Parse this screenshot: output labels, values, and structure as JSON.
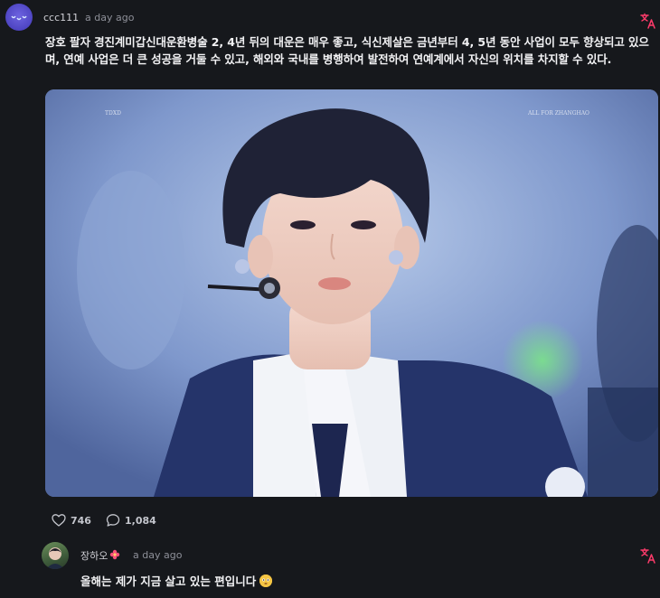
{
  "post": {
    "username": "ccc111",
    "timestamp": "a day ago",
    "text": "장호 팔자 경진계미갑신대운환병술 2, 4년 뒤의 대운은 매우 좋고, 식신제살은 금년부터 4, 5년 동안 사업이 모두 향상되고 있으며, 연예 사업은 더 큰 성공을 거둘 수 있고, 해외와 국내를 병행하여 발전하여 연예계에서 자신의 위치를 차지할 수 있다.",
    "image": {
      "watermark_left": "TDXD",
      "watermark_right": "ALL FOR ZHANGHAO"
    },
    "likes": "746",
    "comments": "1,084",
    "translate_icon": "translate-icon",
    "colors": {
      "accent": "#ff3b6b",
      "background": "#16181c"
    }
  },
  "reply": {
    "username": "장하오",
    "badge_icon": "flower-icon",
    "timestamp": "a day ago",
    "text": "올해는 제가 지금 살고 있는 편입니다",
    "emoji": "flushed-face-icon"
  }
}
